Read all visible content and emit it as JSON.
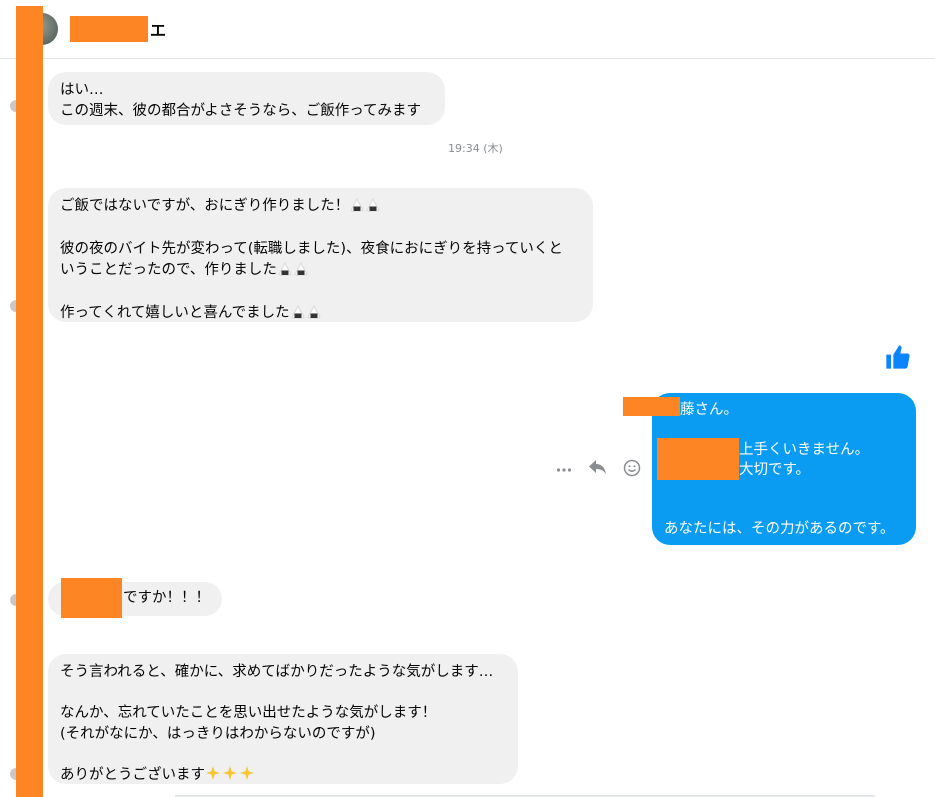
{
  "header": {
    "name_suffix": "エ"
  },
  "timestamp": "19:34 (木)",
  "messages": {
    "m1": {
      "line1": "はい…",
      "line2": "この週末、彼の都合がよさそうなら、ご飯作ってみます"
    },
    "m2": {
      "line1": "ご飯ではないですが、おにぎり作りました！",
      "line2": "彼の夜のバイト先が変わって(転職しました)、夜食におにぎりを持っていくと",
      "line3": "いうことだったので、作りました",
      "line4": "作ってくれて嬉しいと喜んでました"
    },
    "m3": {
      "line1": "藤さん。",
      "line2": "上手くいきません。",
      "line3": "大切です。",
      "line4": "あなたには、その力があるのです。"
    },
    "m4": {
      "text": "ですか！！！"
    },
    "m5": {
      "line1": "そう言われると、確かに、求めてばかりだったような気がします…",
      "line2": "なんか、忘れていたことを思い出せたような気がします！",
      "line3": "(それがなにか、はっきりはわからないのですが)",
      "line4": "ありがとうございます"
    }
  },
  "icons": {
    "rice": "onigiri-icon",
    "like": "thumbs-up-icon",
    "more": "more-dots-icon",
    "reply": "reply-icon",
    "react": "smiley-icon",
    "sparkles": "sparkles-icon"
  },
  "colors": {
    "outgoing": "#0a9bf3",
    "incoming": "#f0f0f0",
    "redaction": "#fd8523",
    "like": "#0a84ff"
  }
}
